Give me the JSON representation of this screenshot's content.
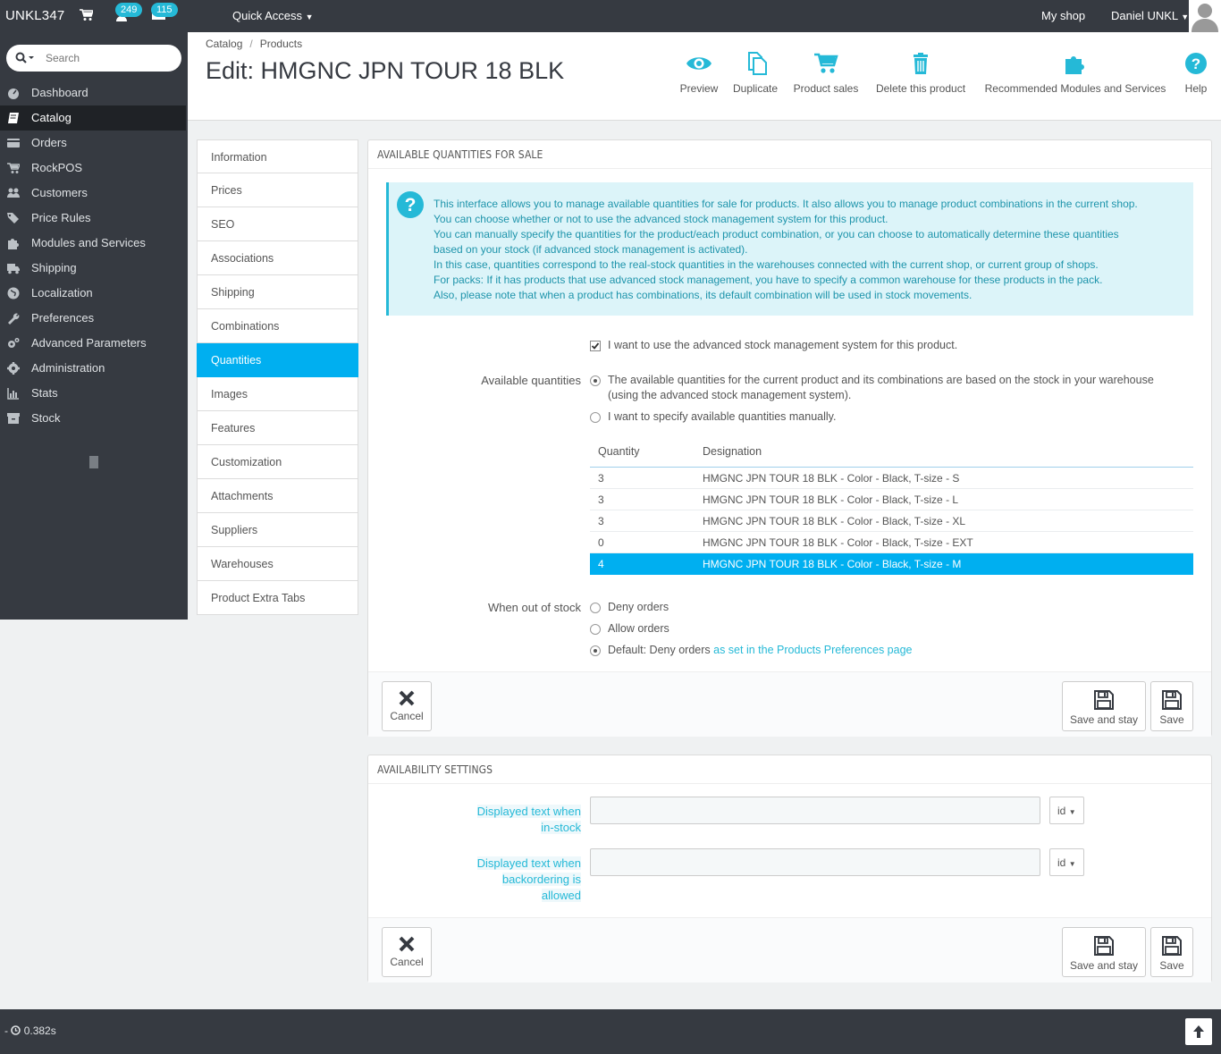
{
  "topbar": {
    "brand": "UNKL347",
    "orders_badge": "249",
    "messages_badge": "115",
    "quick_access": "Quick Access",
    "my_shop": "My shop",
    "user_name": "Daniel UNKL"
  },
  "sidebar": {
    "search_placeholder": "Search",
    "items": [
      {
        "label": "Dashboard",
        "icon": "dashboard-icon"
      },
      {
        "label": "Catalog",
        "icon": "book-icon"
      },
      {
        "label": "Orders",
        "icon": "credit-card-icon"
      },
      {
        "label": "RockPOS",
        "icon": "cart-icon"
      },
      {
        "label": "Customers",
        "icon": "users-icon"
      },
      {
        "label": "Price Rules",
        "icon": "tags-icon"
      },
      {
        "label": "Modules and Services",
        "icon": "puzzle-icon"
      },
      {
        "label": "Shipping",
        "icon": "truck-icon"
      },
      {
        "label": "Localization",
        "icon": "globe-icon"
      },
      {
        "label": "Preferences",
        "icon": "wrench-icon"
      },
      {
        "label": "Advanced Parameters",
        "icon": "cogs-icon"
      },
      {
        "label": "Administration",
        "icon": "cog-icon"
      },
      {
        "label": "Stats",
        "icon": "bar-chart-icon"
      },
      {
        "label": "Stock",
        "icon": "archive-icon"
      }
    ]
  },
  "header": {
    "breadcrumb_1": "Catalog",
    "breadcrumb_sep": "/",
    "breadcrumb_2": "Products",
    "title": "Edit: HMGNC JPN TOUR 18 BLK",
    "toolbar": {
      "preview": "Preview",
      "duplicate": "Duplicate",
      "product_sales": "Product sales",
      "delete": "Delete this product",
      "recommended": "Recommended Modules and Services",
      "help": "Help"
    }
  },
  "tabs": [
    "Information",
    "Prices",
    "SEO",
    "Associations",
    "Shipping",
    "Combinations",
    "Quantities",
    "Images",
    "Features",
    "Customization",
    "Attachments",
    "Suppliers",
    "Warehouses",
    "Product Extra Tabs"
  ],
  "quantities_panel": {
    "heading": "AVAILABLE QUANTITIES FOR SALE",
    "info_lines": [
      "This interface allows you to manage available quantities for sale for products. It also allows you to manage product combinations in the current shop.",
      "You can choose whether or not to use the advanced stock management system for this product.",
      "You can manually specify the quantities for the product/each product combination, or you can choose to automatically determine these quantities",
      "based on your stock (if advanced stock management is activated).",
      "In this case, quantities correspond to the real-stock quantities in the warehouses connected with the current shop, or current group of shops.",
      "For packs: If it has products that use advanced stock management, you have to specify a common warehouse for these products in the pack.",
      "Also, please note that when a product has combinations, its default combination will be used in stock movements."
    ],
    "asm_checkbox_label": "I want to use the advanced stock management system for this product.",
    "available_quantities_label": "Available quantities",
    "option_asm_line1": "The available quantities for the current product and its combinations are based on the stock in your warehouse",
    "option_asm_line2": "(using the advanced stock management system).",
    "option_manual": "I want to specify available quantities manually.",
    "table": {
      "headers": [
        "Quantity",
        "Designation"
      ],
      "rows": [
        {
          "quantity": "3",
          "designation": "HMGNC JPN TOUR 18 BLK - Color - Black, T-size - S"
        },
        {
          "quantity": "3",
          "designation": "HMGNC JPN TOUR 18 BLK - Color - Black, T-size - L"
        },
        {
          "quantity": "3",
          "designation": "HMGNC JPN TOUR 18 BLK - Color - Black, T-size - XL"
        },
        {
          "quantity": "0",
          "designation": "HMGNC JPN TOUR 18 BLK - Color - Black, T-size - EXT"
        },
        {
          "quantity": "4",
          "designation": "HMGNC JPN TOUR 18 BLK - Color - Black, T-size - M"
        }
      ]
    },
    "out_of_stock_label": "When out of stock",
    "deny_orders": "Deny orders",
    "allow_orders": "Allow orders",
    "default_option": "Default: Deny orders",
    "default_link": "as set in the Products Preferences page",
    "cancel": "Cancel",
    "save_and_stay": "Save and stay",
    "save": "Save"
  },
  "availability_panel": {
    "heading": "AVAILABILITY SETTINGS",
    "in_stock_label_1": "Displayed text when",
    "in_stock_label_2": "in-stock",
    "backorder_label_1": "Displayed text when",
    "backorder_label_2": "backordering is",
    "backorder_label_3": "allowed",
    "lang": "id",
    "cancel": "Cancel",
    "save_and_stay": "Save and stay",
    "save": "Save"
  },
  "footer": {
    "perf": "- ",
    "time": "0.382s"
  },
  "colors": {
    "accent": "#00aff0",
    "info": "#25b9d7",
    "dark": "#363a41"
  }
}
